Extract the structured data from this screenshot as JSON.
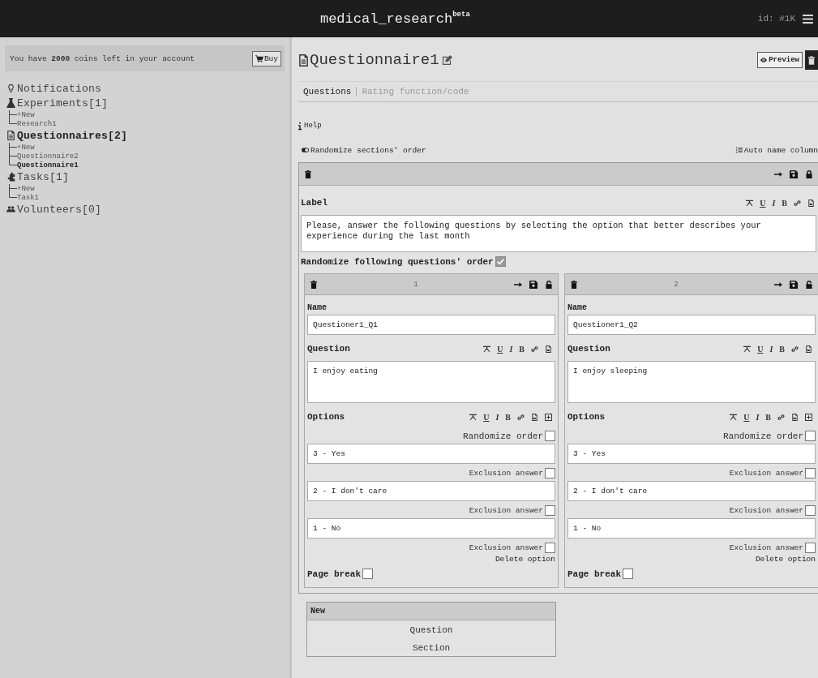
{
  "header": {
    "title": "medical_research",
    "badge": "beta",
    "id_label": "id: #1K"
  },
  "sidebar": {
    "coins_text": "You have **2000** coins left in your account",
    "buy_button": "Buy",
    "groups": [
      {
        "label": "Notifications",
        "selected": false
      },
      {
        "label": "Experiments[1]",
        "selected": false,
        "children": [
          {
            "label": "+New",
            "selected": false
          },
          {
            "label": "Research1",
            "selected": false
          }
        ]
      },
      {
        "label": "Questionnaires[2]",
        "selected": true,
        "children": [
          {
            "label": "+New",
            "selected": false
          },
          {
            "label": "Questionnaire2",
            "selected": false
          },
          {
            "label": "Questionnaire1",
            "selected": true
          }
        ]
      },
      {
        "label": "Tasks[1]",
        "selected": false,
        "children": [
          {
            "label": "+New",
            "selected": false
          },
          {
            "label": "Task1",
            "selected": false
          }
        ]
      },
      {
        "label": "Volunteers[0]",
        "selected": false
      }
    ]
  },
  "editor": {
    "title": "Questionnaire1",
    "preview_button": "Preview",
    "tabs": [
      {
        "label": "Questions",
        "selected": true
      },
      {
        "label": "Rating function/code",
        "selected": false
      }
    ],
    "help": "Help",
    "randomize_sections": "Randomize sections' order",
    "auto_name": "Auto name column",
    "section": {
      "locked": true,
      "label_title": "Label",
      "toolbar": [
        {
          "kind": "clear"
        },
        {
          "kind": "underline",
          "label": "U"
        },
        {
          "kind": "italic",
          "label": "I"
        },
        {
          "kind": "bold",
          "label": "B"
        },
        {
          "kind": "link"
        },
        {
          "kind": "file"
        }
      ],
      "label_text": "Please, answer the following questions by selecting the option that better describes your experience during the last month",
      "randomize_following": {
        "label": "Randomize following questions' order",
        "checked": true
      },
      "questions": [
        {
          "number": "1",
          "locked": false,
          "name_label": "Name",
          "name": "Questioner1_Q1",
          "question_label": "Question",
          "question_toolbar": [
            {
              "kind": "clear"
            },
            {
              "kind": "underline",
              "label": "U"
            },
            {
              "kind": "italic",
              "label": "I"
            },
            {
              "kind": "bold",
              "label": "B"
            },
            {
              "kind": "link"
            },
            {
              "kind": "file"
            }
          ],
          "question": "I enjoy eating",
          "options_label": "Options",
          "options_toolbar": [
            {
              "kind": "clear"
            },
            {
              "kind": "underline",
              "label": "U"
            },
            {
              "kind": "italic",
              "label": "I"
            },
            {
              "kind": "bold",
              "label": "B"
            },
            {
              "kind": "link"
            },
            {
              "kind": "file"
            },
            {
              "kind": "add"
            }
          ],
          "randomize_order": {
            "label": "Randomize order",
            "checked": false
          },
          "options": [
            {
              "text": "3 - Yes",
              "exclusion_label": "Exclusion answer",
              "exclusion": false
            },
            {
              "text": "2 - I don't care",
              "exclusion_label": "Exclusion answer",
              "exclusion": false
            },
            {
              "text": "1 - No",
              "exclusion_label": "Exclusion answer",
              "exclusion": false
            }
          ],
          "delete_option": "Delete option",
          "page_break": {
            "label": "Page break",
            "checked": false
          }
        },
        {
          "number": "2",
          "locked": false,
          "name_label": "Name",
          "name": "Questioner1_Q2",
          "question_label": "Question",
          "question_toolbar": [
            {
              "kind": "clear"
            },
            {
              "kind": "underline",
              "label": "U"
            },
            {
              "kind": "italic",
              "label": "I"
            },
            {
              "kind": "bold",
              "label": "B"
            },
            {
              "kind": "link"
            },
            {
              "kind": "file"
            }
          ],
          "question": "I enjoy sleeping",
          "options_label": "Options",
          "options_toolbar": [
            {
              "kind": "clear"
            },
            {
              "kind": "underline",
              "label": "U"
            },
            {
              "kind": "italic",
              "label": "I"
            },
            {
              "kind": "bold",
              "label": "B"
            },
            {
              "kind": "link"
            },
            {
              "kind": "file"
            },
            {
              "kind": "add"
            }
          ],
          "randomize_order": {
            "label": "Randomize order",
            "checked": false
          },
          "options": [
            {
              "text": "3 - Yes",
              "exclusion_label": "Exclusion answer",
              "exclusion": false
            },
            {
              "text": "2 - I don't care",
              "exclusion_label": "Exclusion answer",
              "exclusion": false
            },
            {
              "text": "1 - No",
              "exclusion_label": "Exclusion answer",
              "exclusion": false
            }
          ],
          "delete_option": "Delete option",
          "page_break": {
            "label": "Page break",
            "checked": false
          }
        }
      ]
    },
    "new_menu": {
      "title": "New",
      "items": [
        "Question",
        "Section"
      ]
    }
  }
}
